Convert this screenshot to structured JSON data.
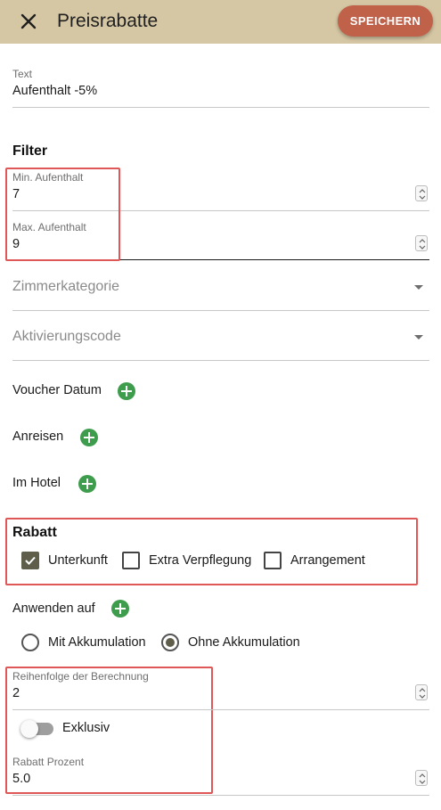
{
  "header": {
    "title": "Preisrabatte",
    "save_label": "SPEICHERN"
  },
  "text_field": {
    "label": "Text",
    "value": "Aufenthalt -5%"
  },
  "filter": {
    "title": "Filter",
    "min_stay": {
      "label": "Min. Aufenthalt",
      "value": "7"
    },
    "max_stay": {
      "label": "Max. Aufenthalt",
      "value": "9"
    },
    "room_category": {
      "placeholder": "Zimmerkategorie"
    },
    "activation_code": {
      "placeholder": "Aktivierungscode"
    },
    "voucher_date": {
      "label": "Voucher Datum"
    },
    "arrivals": {
      "label": "Anreisen"
    },
    "in_hotel": {
      "label": "Im Hotel"
    }
  },
  "discount": {
    "title": "Rabatt",
    "options": [
      {
        "label": "Unterkunft",
        "checked": true
      },
      {
        "label": "Extra Verpflegung",
        "checked": false
      },
      {
        "label": "Arrangement",
        "checked": false
      }
    ]
  },
  "apply_to": {
    "label": "Anwenden auf"
  },
  "accumulation": {
    "options": [
      {
        "label": "Mit Akkumulation",
        "selected": false
      },
      {
        "label": "Ohne Akkumulation",
        "selected": true
      }
    ]
  },
  "calc_order": {
    "label": "Reihenfolge der Berechnung",
    "value": "2"
  },
  "exclusive": {
    "label": "Exklusiv",
    "on": false
  },
  "discount_percent": {
    "label": "Rabatt Prozent",
    "value": "5.0"
  },
  "colors": {
    "appbar": "#d6c7a4",
    "save_button": "#c0614a",
    "add_icon": "#3e9d4c",
    "highlight_box": "#e05757"
  }
}
